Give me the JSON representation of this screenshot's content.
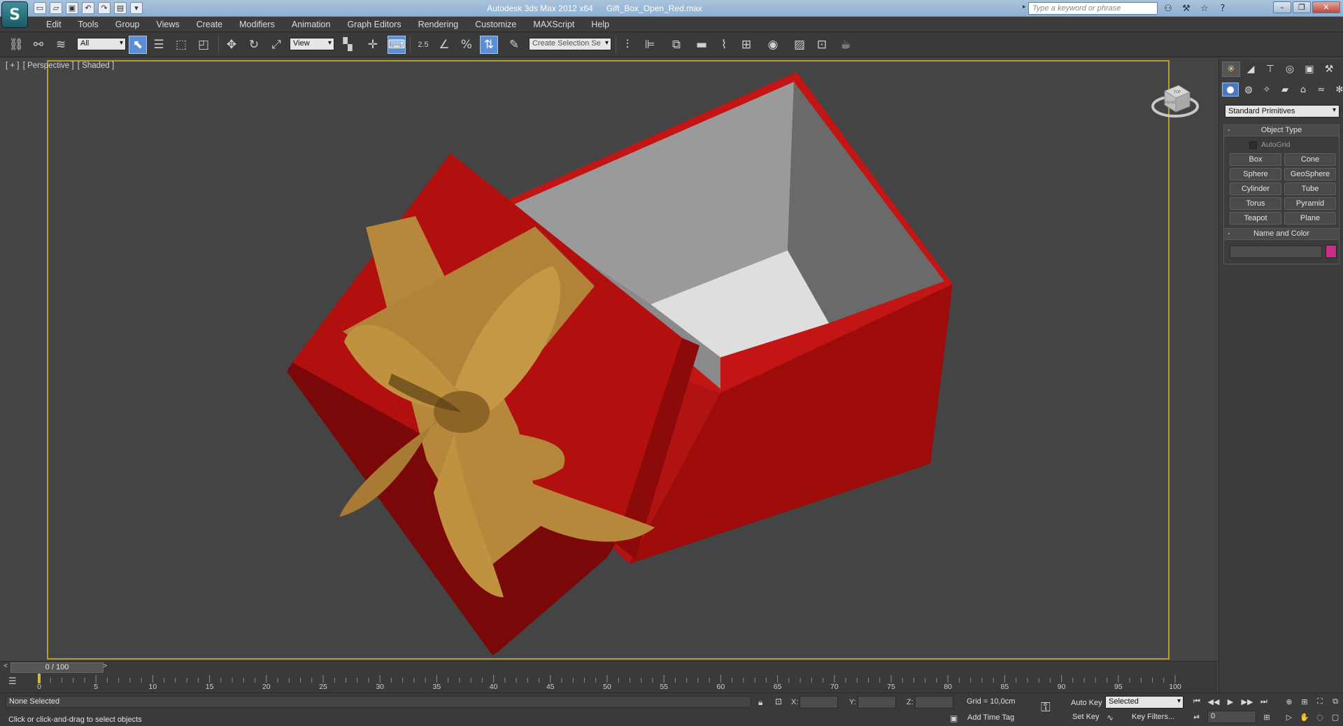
{
  "window": {
    "app_title": "Autodesk 3ds Max  2012 x64",
    "file_name": "Gift_Box_Open_Red.max",
    "search_placeholder": "Type a keyword or phrase",
    "logo_glyph": "S"
  },
  "menu": [
    "Edit",
    "Tools",
    "Group",
    "Views",
    "Create",
    "Modifiers",
    "Animation",
    "Graph Editors",
    "Rendering",
    "Customize",
    "MAXScript",
    "Help"
  ],
  "toolbar": {
    "selection_filter": "All",
    "reference_coord": "View",
    "snap_value": "2.5",
    "named_selection_placeholder": "Create Selection Se"
  },
  "viewport": {
    "label_plus": "[ + ]",
    "label_view": "[ Perspective ]",
    "label_shading": "[ Shaded ]",
    "viewcube_top": "TOP",
    "viewcube_front": "FRONT",
    "colors": {
      "background": "#444444",
      "box_red": "#a80f0f",
      "box_dark_red": "#7d0808",
      "ribbon_gold": "#b8893d",
      "interior_gray": "#8a8a8a",
      "frame_yellow": "#b89d2e"
    }
  },
  "command_panel": {
    "primitive_category": "Standard Primitives",
    "object_type_title": "Object Type",
    "autogrid_label": "AutoGrid",
    "object_buttons": [
      "Box",
      "Cone",
      "Sphere",
      "GeoSphere",
      "Cylinder",
      "Tube",
      "Torus",
      "Pyramid",
      "Teapot",
      "Plane"
    ],
    "name_color_title": "Name and Color",
    "swatch_color": "#cc2c88"
  },
  "timeline": {
    "slider_text": "0 / 100",
    "ticks": [
      "0",
      "5",
      "10",
      "15",
      "20",
      "25",
      "30",
      "35",
      "40",
      "45",
      "50",
      "55",
      "60",
      "65",
      "70",
      "75",
      "80",
      "85",
      "90",
      "95",
      "100"
    ]
  },
  "status": {
    "selection_text": "None Selected",
    "prompt_text": "Click or click-and-drag to select objects",
    "x_label": "X:",
    "y_label": "Y:",
    "z_label": "Z:",
    "grid_text": "Grid = 10,0cm",
    "add_time_tag": "Add Time Tag",
    "auto_key": "Auto Key",
    "set_key": "Set Key",
    "key_mode_selected": "Selected",
    "key_filters": "Key Filters...",
    "current_frame": "0"
  }
}
